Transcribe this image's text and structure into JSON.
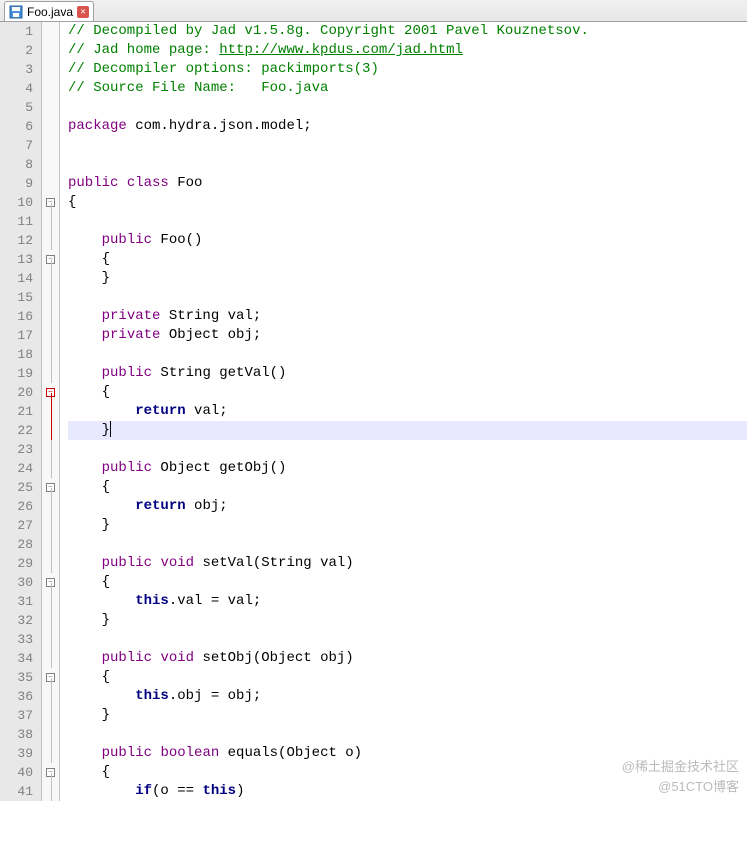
{
  "tab": {
    "filename": "Foo.java"
  },
  "watermarks": {
    "top": "@稀土掘金技术社区",
    "bottom": "@51CTO博客"
  },
  "code": {
    "lines": [
      {
        "n": 1,
        "fold": "",
        "tokens": [
          {
            "cls": "kw-green",
            "t": "// Decompiled by Jad v1.5.8g. Copyright 2001 Pavel Kouznetsov."
          }
        ]
      },
      {
        "n": 2,
        "fold": "",
        "tokens": [
          {
            "cls": "kw-green",
            "t": "// Jad home page: "
          },
          {
            "cls": "link",
            "t": "http://www.kpdus.com/jad.html"
          }
        ]
      },
      {
        "n": 3,
        "fold": "",
        "tokens": [
          {
            "cls": "kw-green",
            "t": "// Decompiler options: packimports(3) "
          }
        ]
      },
      {
        "n": 4,
        "fold": "",
        "tokens": [
          {
            "cls": "kw-green",
            "t": "// Source File Name:   Foo.java"
          }
        ]
      },
      {
        "n": 5,
        "fold": "",
        "tokens": []
      },
      {
        "n": 6,
        "fold": "",
        "tokens": [
          {
            "cls": "kw-purple",
            "t": "package"
          },
          {
            "cls": "text-black",
            "t": " com.hydra.json.model;"
          }
        ]
      },
      {
        "n": 7,
        "fold": "",
        "tokens": []
      },
      {
        "n": 8,
        "fold": "",
        "tokens": []
      },
      {
        "n": 9,
        "fold": "",
        "tokens": [
          {
            "cls": "kw-purple",
            "t": "public"
          },
          {
            "cls": "text-black",
            "t": " "
          },
          {
            "cls": "kw-purple",
            "t": "class"
          },
          {
            "cls": "text-black",
            "t": " Foo"
          }
        ]
      },
      {
        "n": 10,
        "fold": "box",
        "tokens": [
          {
            "cls": "text-black",
            "t": "{"
          }
        ]
      },
      {
        "n": 11,
        "fold": "line",
        "tokens": []
      },
      {
        "n": 12,
        "fold": "line",
        "tokens": [
          {
            "cls": "text-black",
            "t": "    "
          },
          {
            "cls": "kw-purple",
            "t": "public"
          },
          {
            "cls": "text-black",
            "t": " Foo()"
          }
        ]
      },
      {
        "n": 13,
        "fold": "box",
        "tokens": [
          {
            "cls": "text-black",
            "t": "    {"
          }
        ]
      },
      {
        "n": 14,
        "fold": "line",
        "tokens": [
          {
            "cls": "text-black",
            "t": "    }"
          }
        ]
      },
      {
        "n": 15,
        "fold": "line",
        "tokens": []
      },
      {
        "n": 16,
        "fold": "line",
        "tokens": [
          {
            "cls": "text-black",
            "t": "    "
          },
          {
            "cls": "kw-purple",
            "t": "private"
          },
          {
            "cls": "text-black",
            "t": " String val;"
          }
        ]
      },
      {
        "n": 17,
        "fold": "line",
        "tokens": [
          {
            "cls": "text-black",
            "t": "    "
          },
          {
            "cls": "kw-purple",
            "t": "private"
          },
          {
            "cls": "text-black",
            "t": " Object obj;"
          }
        ]
      },
      {
        "n": 18,
        "fold": "line",
        "tokens": []
      },
      {
        "n": 19,
        "fold": "line",
        "tokens": [
          {
            "cls": "text-black",
            "t": "    "
          },
          {
            "cls": "kw-purple",
            "t": "public"
          },
          {
            "cls": "text-black",
            "t": " String getVal()"
          }
        ]
      },
      {
        "n": 20,
        "fold": "box-red",
        "tokens": [
          {
            "cls": "text-black",
            "t": "    {"
          }
        ]
      },
      {
        "n": 21,
        "fold": "line-red",
        "tokens": [
          {
            "cls": "text-black",
            "t": "        "
          },
          {
            "cls": "kw-navy",
            "t": "return"
          },
          {
            "cls": "text-black",
            "t": " val;"
          }
        ]
      },
      {
        "n": 22,
        "fold": "line-red",
        "hl": true,
        "tokens": [
          {
            "cls": "text-black",
            "t": "    }"
          }
        ],
        "cursor": true
      },
      {
        "n": 23,
        "fold": "line",
        "tokens": []
      },
      {
        "n": 24,
        "fold": "line",
        "tokens": [
          {
            "cls": "text-black",
            "t": "    "
          },
          {
            "cls": "kw-purple",
            "t": "public"
          },
          {
            "cls": "text-black",
            "t": " Object getObj()"
          }
        ]
      },
      {
        "n": 25,
        "fold": "box",
        "tokens": [
          {
            "cls": "text-black",
            "t": "    {"
          }
        ]
      },
      {
        "n": 26,
        "fold": "line",
        "tokens": [
          {
            "cls": "text-black",
            "t": "        "
          },
          {
            "cls": "kw-navy",
            "t": "return"
          },
          {
            "cls": "text-black",
            "t": " obj;"
          }
        ]
      },
      {
        "n": 27,
        "fold": "line",
        "tokens": [
          {
            "cls": "text-black",
            "t": "    }"
          }
        ]
      },
      {
        "n": 28,
        "fold": "line",
        "tokens": []
      },
      {
        "n": 29,
        "fold": "line",
        "tokens": [
          {
            "cls": "text-black",
            "t": "    "
          },
          {
            "cls": "kw-purple",
            "t": "public"
          },
          {
            "cls": "text-black",
            "t": " "
          },
          {
            "cls": "kw-purple",
            "t": "void"
          },
          {
            "cls": "text-black",
            "t": " setVal(String val)"
          }
        ]
      },
      {
        "n": 30,
        "fold": "box",
        "tokens": [
          {
            "cls": "text-black",
            "t": "    {"
          }
        ]
      },
      {
        "n": 31,
        "fold": "line",
        "tokens": [
          {
            "cls": "text-black",
            "t": "        "
          },
          {
            "cls": "kw-navy",
            "t": "this"
          },
          {
            "cls": "text-black",
            "t": ".val = val;"
          }
        ]
      },
      {
        "n": 32,
        "fold": "line",
        "tokens": [
          {
            "cls": "text-black",
            "t": "    }"
          }
        ]
      },
      {
        "n": 33,
        "fold": "line",
        "tokens": []
      },
      {
        "n": 34,
        "fold": "line",
        "tokens": [
          {
            "cls": "text-black",
            "t": "    "
          },
          {
            "cls": "kw-purple",
            "t": "public"
          },
          {
            "cls": "text-black",
            "t": " "
          },
          {
            "cls": "kw-purple",
            "t": "void"
          },
          {
            "cls": "text-black",
            "t": " setObj(Object obj)"
          }
        ]
      },
      {
        "n": 35,
        "fold": "box",
        "tokens": [
          {
            "cls": "text-black",
            "t": "    {"
          }
        ]
      },
      {
        "n": 36,
        "fold": "line",
        "tokens": [
          {
            "cls": "text-black",
            "t": "        "
          },
          {
            "cls": "kw-navy",
            "t": "this"
          },
          {
            "cls": "text-black",
            "t": ".obj = obj;"
          }
        ]
      },
      {
        "n": 37,
        "fold": "line",
        "tokens": [
          {
            "cls": "text-black",
            "t": "    }"
          }
        ]
      },
      {
        "n": 38,
        "fold": "line",
        "tokens": []
      },
      {
        "n": 39,
        "fold": "line",
        "tokens": [
          {
            "cls": "text-black",
            "t": "    "
          },
          {
            "cls": "kw-purple",
            "t": "public"
          },
          {
            "cls": "text-black",
            "t": " "
          },
          {
            "cls": "kw-purple",
            "t": "boolean"
          },
          {
            "cls": "text-black",
            "t": " equals(Object o)"
          }
        ]
      },
      {
        "n": 40,
        "fold": "box",
        "tokens": [
          {
            "cls": "text-black",
            "t": "    {"
          }
        ]
      },
      {
        "n": 41,
        "fold": "line",
        "tokens": [
          {
            "cls": "text-black",
            "t": "        "
          },
          {
            "cls": "kw-navy",
            "t": "if"
          },
          {
            "cls": "text-black",
            "t": "(o == "
          },
          {
            "cls": "kw-navy",
            "t": "this"
          },
          {
            "cls": "text-black",
            "t": ")"
          }
        ]
      }
    ]
  }
}
